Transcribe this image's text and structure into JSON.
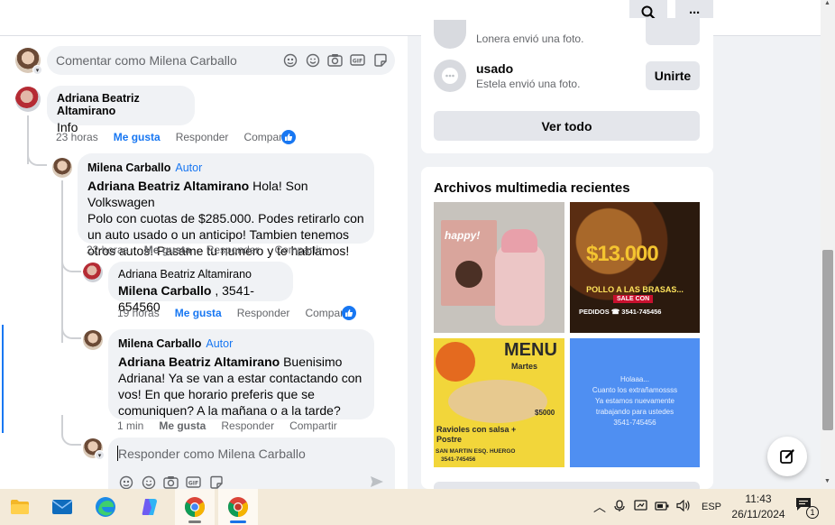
{
  "colors": {
    "accent": "#1877f2",
    "bubble": "#f0f2f5",
    "muted": "#65676b",
    "taskbar": "#f3ead9"
  },
  "topbar": {
    "search_icon": "search-icon",
    "more_label": "···"
  },
  "comments": {
    "top_composer_placeholder": "Comentar como Milena Carballo",
    "root": {
      "author": "Adriana Beatriz Altamirano",
      "text": "Info",
      "time": "23 horas",
      "like": "Me gusta",
      "reply": "Responder",
      "share": "Compartir"
    },
    "reply1": {
      "author": "Milena Carballo",
      "tag": "Autor",
      "mention": "Adriana Beatriz Altamirano",
      "text_line1": " Hola! Son Volkswagen",
      "text_line2": "Polo con cuotas de $285.000. Podes retirarlo con",
      "text_line3": "un auto usado o un anticipo! Tambien tenemos",
      "text_line4": "otros autos. Pasame tu numero y te hablamos!",
      "time": "22 horas",
      "like": "Me gusta",
      "reply": "Responder",
      "share": "Compartir"
    },
    "reply2": {
      "author": "Adriana Beatriz Altamirano",
      "mention": "Milena Carballo",
      "text": " , 3541-654560",
      "time": "19 horas",
      "like": "Me gusta",
      "reply": "Responder",
      "share": "Compartir"
    },
    "reply3": {
      "author": "Milena Carballo",
      "tag": "Autor",
      "mention": "Adriana Beatriz Altamirano",
      "text_line1": " Buenisimo",
      "text_line2": "Adriana! Ya se van a estar contactando con",
      "text_line3": "vos! En que horario preferis que se",
      "text_line4": "comuniquen? A la mañana o a la tarde?",
      "time": "1 min",
      "like": "Me gusta",
      "reply": "Responder",
      "share": "Compartir"
    },
    "reply_composer_placeholder": "Responder como Milena Carballo"
  },
  "groups": {
    "partial_sub": "Lonera envió una foto.",
    "item": {
      "name": "usado",
      "sub": "Estela envió una foto.",
      "join": "Unirte"
    },
    "see_all": "Ver todo"
  },
  "media": {
    "title": "Archivos multimedia recientes",
    "thumb1_text": "happy!",
    "thumb2_price": "$13.000",
    "thumb2_line1": "POLLO A LAS BRASAS...",
    "thumb2_line2": "SALE CON",
    "thumb2_line3": "PEDIDOS ☎ 3541-745456",
    "thumb3_title": "MENU",
    "thumb3_sub": "Martes",
    "thumb3_price": "$5000",
    "thumb3_dish1": "Ravioles con salsa +",
    "thumb3_dish2": "Postre",
    "thumb3_addr": "SAN MARTIN ESQ. HUERGO",
    "thumb3_phone": "3541-745456",
    "thumb4_l1": "Holaaa...",
    "thumb4_l2": "Cuanto los extrañamossss",
    "thumb4_l3": "Ya estamos nuevamente",
    "thumb4_l4": "trabajando para ustedes",
    "thumb4_l5": "3541-745456"
  },
  "taskbar": {
    "lang": "ESP",
    "time": "11:43",
    "date": "26/11/2024",
    "notif_count": "1"
  }
}
